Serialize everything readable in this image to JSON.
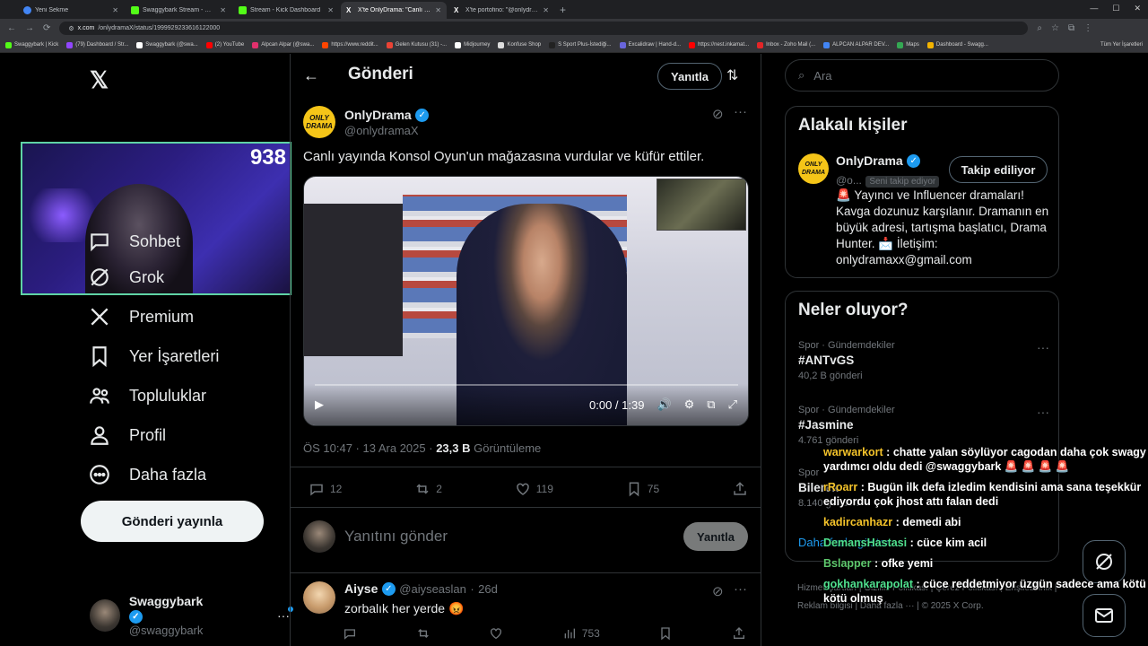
{
  "browser": {
    "tabs": [
      {
        "label": "Yeni Sekme",
        "color": "#4285f4",
        "active": false
      },
      {
        "label": "Swaggybark Stream - Watch Li",
        "color": "#53fc18",
        "active": false
      },
      {
        "label": "Stream - Kick Dashboard",
        "color": "#53fc18",
        "active": false
      },
      {
        "label": "X'te OnlyDrama: \"Canlı yayında",
        "color": "#ffffff",
        "active": true
      },
      {
        "label": "X'te portofino: \"@onlydramaX",
        "color": "#ffffff",
        "active": false
      }
    ],
    "url_domain": "x.com",
    "url_path": "/onlydramaX/status/1999929233616122000",
    "bookmarks": [
      {
        "label": "Swaggybark | Kick",
        "color": "#53fc18"
      },
      {
        "label": "(79) Dashboard / Str...",
        "color": "#9146ff"
      },
      {
        "label": "Swaggybark (@swa...",
        "color": "#ffffff"
      },
      {
        "label": "(2) YouTube",
        "color": "#ff0000"
      },
      {
        "label": "Alpcan Alpar (@swa...",
        "color": "#e1306c"
      },
      {
        "label": "https://www.reddit...",
        "color": "#ff4500"
      },
      {
        "label": "Gelen Kutusu (31) -...",
        "color": "#ea4335"
      },
      {
        "label": "Midjourney",
        "color": "#ffffff"
      },
      {
        "label": "Konfuse Shop",
        "color": "#dddddd"
      },
      {
        "label": "S Sport Plus-İstediği...",
        "color": "#222222"
      },
      {
        "label": "Excalidraw | Hand-d...",
        "color": "#6965db"
      },
      {
        "label": "https://nest.inkamat...",
        "color": "#ff0000"
      },
      {
        "label": "Inbox - Zoho Mail (...",
        "color": "#e42527"
      },
      {
        "label": "ALPCAN ALPAR DEV...",
        "color": "#4285f4"
      },
      {
        "label": "Maps",
        "color": "#34a853"
      },
      {
        "label": "Dashboard - Swagg...",
        "color": "#f4b400"
      }
    ],
    "all_bookmarks": "Tüm Yer İşaretleri"
  },
  "left_nav": {
    "items": [
      {
        "label": "Sohbet",
        "icon": "chat-icon"
      },
      {
        "label": "Grok",
        "icon": "grok-icon"
      },
      {
        "label": "Premium",
        "icon": "x-icon"
      },
      {
        "label": "Yer İşaretleri",
        "icon": "bookmark-icon"
      },
      {
        "label": "Topluluklar",
        "icon": "communities-icon"
      },
      {
        "label": "Profil",
        "icon": "person-icon"
      },
      {
        "label": "Daha fazla",
        "icon": "more-icon"
      }
    ],
    "post_button": "Gönderi yayınla",
    "user_name": "Swaggybark",
    "user_handle": "@swaggybark",
    "webcam_counter": "938"
  },
  "post": {
    "header_title": "Gönderi",
    "reply_top": "Yanıtla",
    "author_name": "OnlyDrama",
    "author_handle": "@onlydramaX",
    "avatar_text": "ONLY DRAMA",
    "text": "Canlı yayında Konsol Oyun'un mağazasına vurdular ve küfür ettiler.",
    "video_time": "0:00 / 1:39",
    "time": "ÖS 10:47",
    "date": "13 Ara 2025",
    "views": "23,3 B",
    "views_label": "Görüntüleme",
    "replies": "12",
    "reposts": "2",
    "likes": "119",
    "bookmarks": "75",
    "reply_placeholder": "Yanıtını gönder",
    "reply_button": "Yanıtla"
  },
  "comment": {
    "name": "Aiyse",
    "handle": "@aiyseaslan",
    "age": "26d",
    "text": "zorbalık her yerde 😡",
    "views": "753"
  },
  "sidebar": {
    "search_placeholder": "Ara",
    "related_title": "Alakalı kişiler",
    "related_name": "OnlyDrama",
    "related_handle": "@o...",
    "follows_you": "Seni takip ediyor",
    "following_button": "Takip ediliyor",
    "bio": "🚨 Yayıncı ve Influencer dramaları! Kavga dozunuz karşılanır. Dramanın en büyük adresi, tartışma başlatıcı, Drama Hunter. 📩 İletişim: onlydramaxx@gmail.com",
    "trends_title": "Neler oluyor?",
    "trends": [
      {
        "category": "Spor · Gündemdekiler",
        "title": "#ANTvGS",
        "count": "40,2 B gönderi"
      },
      {
        "category": "Spor · Gündemdekiler",
        "title": "#Jasmine",
        "count": "4.761 gönderi"
      },
      {
        "category": "Spor",
        "title": "Bilerek",
        "count": "8.140 gönderi"
      }
    ],
    "show_more": "Daha fazla göster",
    "footer": "Hizmet Şartları | Gizlilik Politikası | Çerez Politikası | Erişilebilirlik | Reklam bilgisi | Daha fazla ··· | © 2025 X Corp."
  },
  "chat": [
    {
      "user": "warwarkort",
      "text": "chatte yalan söylüyor cagodan daha çok swagy yardımcı oldu dedi @swaggybark 🚨 🚨 🚨 🚨"
    },
    {
      "user": "rRoarr",
      "text": "Bugün ilk defa izledim kendisini ama sana teşekkür ediyordu çok jhost attı falan dedi"
    },
    {
      "user": "kadircanhazr",
      "text": "demedi abi"
    },
    {
      "user": "DemansHastasi",
      "text": "cüce kim acil"
    },
    {
      "user": "Bslapper",
      "text": "ofke yemi"
    },
    {
      "user": "gokhankarapolat",
      "text": "cüce reddetmiyor üzgün sadece ama kötü kötü olmuş"
    }
  ]
}
